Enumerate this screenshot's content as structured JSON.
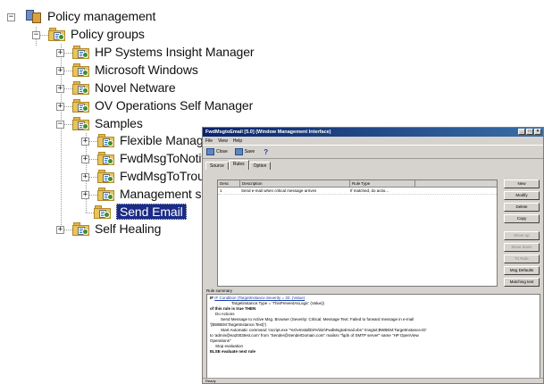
{
  "tree": {
    "root": "Policy management",
    "groups": "Policy groups",
    "items": [
      "HP Systems Insight Manager",
      "Microsoft Windows",
      "Novel Netware",
      "OV Operations Self Manager",
      "Samples",
      "Flexible Manageme",
      "FwdMsgToNotifica",
      "FwdMsgToTrouble",
      "Management serv",
      "Send Email",
      "Self Healing"
    ]
  },
  "window": {
    "title": "FwdMsgtoEmail [5.0] (Window Management Interface)",
    "menu": [
      "File",
      "View",
      "Help"
    ],
    "toolbar": {
      "close": "Close",
      "save": "Save",
      "help": "?"
    },
    "tabs": [
      "Source",
      "Rules",
      "Option"
    ],
    "grid": {
      "columns": [
        "Desc",
        "Description",
        "Rule Type"
      ],
      "rows": [
        [
          "1",
          "Send e-mail when critical message arrives",
          "If matched, do actio..."
        ]
      ]
    },
    "buttons": [
      "New",
      "Modify",
      "Delete",
      "Copy",
      "Move up",
      "Move down",
      "To Rule",
      "Msg Defaults",
      "Matching test"
    ],
    "summary_label": "Rule summary",
    "summary": [
      "IF Condition (TargetInstance.Severity = 32: (Value)",
      "Targetinstance.Type = 'ThisPreventAsLogic' (Value))",
      "of this rule is true THEN",
      "Do Actions",
      "Send Message to Active Msg. Browser (Severity: Critical, Message Text: Failed to forward message in e-mail",
      "'{$WBEM:TargetInstance.Text}')",
      "Start Automatic command 'cscript.exe \"%OvInstallDir%\\bin\\FwdMsgtoEmail.vbs\" /msgtxt:$WBEM:TargetInstance.ID'",
      "to 'admin@ea2003test.com' from \"Sender@SenderDomain.com\" mailsrv \"fqdn of SMTP server\" name \"HP OpenView",
      "Operations\"",
      "Stop evaluation",
      "ELSE evaluate next rule"
    ],
    "status": "Ready"
  }
}
